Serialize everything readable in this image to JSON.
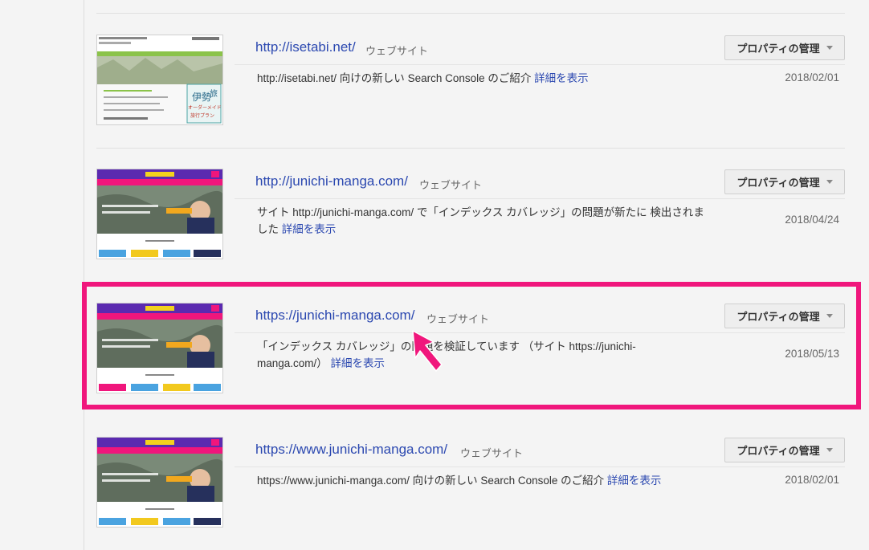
{
  "properties": [
    {
      "url": "http://isetabi.net/",
      "type": "ウェブサイト",
      "manage_label": "プロパティの管理",
      "message_text": "http://isetabi.net/ 向けの新しい Search Console のご紹介",
      "link_label": "詳細を表示",
      "date": "2018/02/01",
      "thumb": "isetabi",
      "thumb_text": [
        "伊勢",
        "旅",
        "オーダーメイド",
        "旅行プラン"
      ]
    },
    {
      "url": "http://junichi-manga.com/",
      "type": "ウェブサイト",
      "manage_label": "プロパティの管理",
      "message_text": "サイト http://junichi-manga.com/ で「インデックス カバレッジ」の問題が新たに 検出されました",
      "link_label": "詳細を表示",
      "date": "2018/04/24",
      "thumb": "manga"
    },
    {
      "url": "https://junichi-manga.com/",
      "type": "ウェブサイト",
      "manage_label": "プロパティの管理",
      "message_text": "「インデックス カバレッジ」の問題を検証しています （サイト https://junichi-manga.com/）",
      "link_label": "詳細を表示",
      "date": "2018/05/13",
      "thumb": "manga"
    },
    {
      "url": "https://www.junichi-manga.com/",
      "type": "ウェブサイト",
      "manage_label": "プロパティの管理",
      "message_text": "https://www.junichi-manga.com/ 向けの新しい Search Console のご紹介",
      "link_label": "詳細を表示",
      "date": "2018/02/01",
      "thumb": "manga"
    }
  ],
  "highlight_color": "#f0167c",
  "link_color": "#2b48b0",
  "cursor_icon": "hand-pointer-cursor-icon"
}
